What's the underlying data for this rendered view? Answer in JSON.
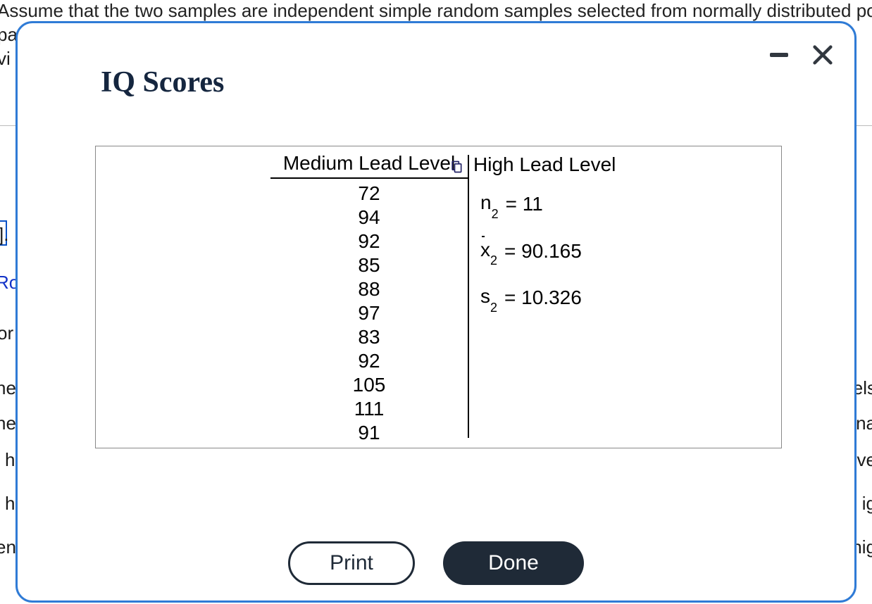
{
  "background": {
    "line1": "Assume that the two samples are independent simple random samples selected from normally distributed po",
    "frag_pa": "pa",
    "frag_vi": "vi",
    "frag_br": "].",
    "frag_ro": "Ro",
    "frag_or": "or",
    "frag_ne1": "ne",
    "frag_ne2": "ne",
    "frag_lh1": "l h",
    "frag_lh2": "l h",
    "frag_en": "en",
    "right_els": "els",
    "right_na": "na",
    "right_ve": "ve",
    "right_ig": "ig",
    "right_nig": "nig"
  },
  "modal": {
    "title": "IQ Scores",
    "print_label": "Print",
    "done_label": "Done"
  },
  "table": {
    "header_left": "Medium Lead Level",
    "header_right": "High Lead Level",
    "left_values": [
      "72",
      "94",
      "92",
      "85",
      "88",
      "97",
      "83",
      "92",
      "105",
      "111",
      "91"
    ],
    "right_stats": {
      "n_label": "n",
      "n_sub": "2",
      "n_eq": "= 11",
      "x_label": "x",
      "x_sub": "2",
      "x_eq": "= 90.165",
      "s_label": "s",
      "s_sub": "2",
      "s_eq": "= 10.326"
    }
  },
  "chart_data": {
    "type": "table",
    "title": "IQ Scores",
    "groups": [
      {
        "name": "Medium Lead Level",
        "values": [
          72,
          94,
          92,
          85,
          88,
          97,
          83,
          92,
          105,
          111,
          91
        ]
      },
      {
        "name": "High Lead Level",
        "summary": {
          "n": 11,
          "mean": 90.165,
          "sd": 10.326
        }
      }
    ]
  }
}
